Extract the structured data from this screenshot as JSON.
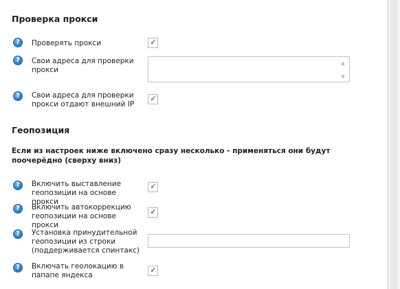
{
  "proxy_check": {
    "title": "Проверка прокси",
    "rows": [
      {
        "label": "Проверять прокси",
        "control": "checkbox",
        "checked": true
      },
      {
        "label": "Свои адреса для проверки прокси",
        "control": "textarea",
        "value": ""
      },
      {
        "label": "Свои адреса для проверки прокси отдают внешний IP",
        "control": "checkbox",
        "checked": true
      }
    ]
  },
  "geoposition": {
    "title": "Геопозиция",
    "note": "Если из настроек ниже включено сразу несколько - применяться они будут поочерёдно (сверху вниз)",
    "rows": [
      {
        "label": "Включить выставление геопозиции на основе прокси",
        "control": "checkbox",
        "checked": true
      },
      {
        "label": "Включить автокоррекцию геопозиции на основе прокси",
        "control": "checkbox",
        "checked": true
      },
      {
        "label": "Установка принудительной геопозиции из строки (поддерживается спинтакс)",
        "control": "text-input",
        "value": ""
      },
      {
        "label": "Включать геолокацию в папапе яндекса",
        "control": "checkbox",
        "checked": true
      }
    ]
  },
  "glyphs": {
    "help": "?",
    "check": "✓",
    "scroll_up": "▲",
    "scroll_down": "▼"
  },
  "icons": {
    "help": "help-question-icon",
    "check": "checkmark-icon"
  },
  "colors": {
    "help_icon": "#2f7ec9",
    "panel_background": "#ffffff",
    "window_background": "#f0f0f0",
    "control_border": "#c3c3c3"
  }
}
